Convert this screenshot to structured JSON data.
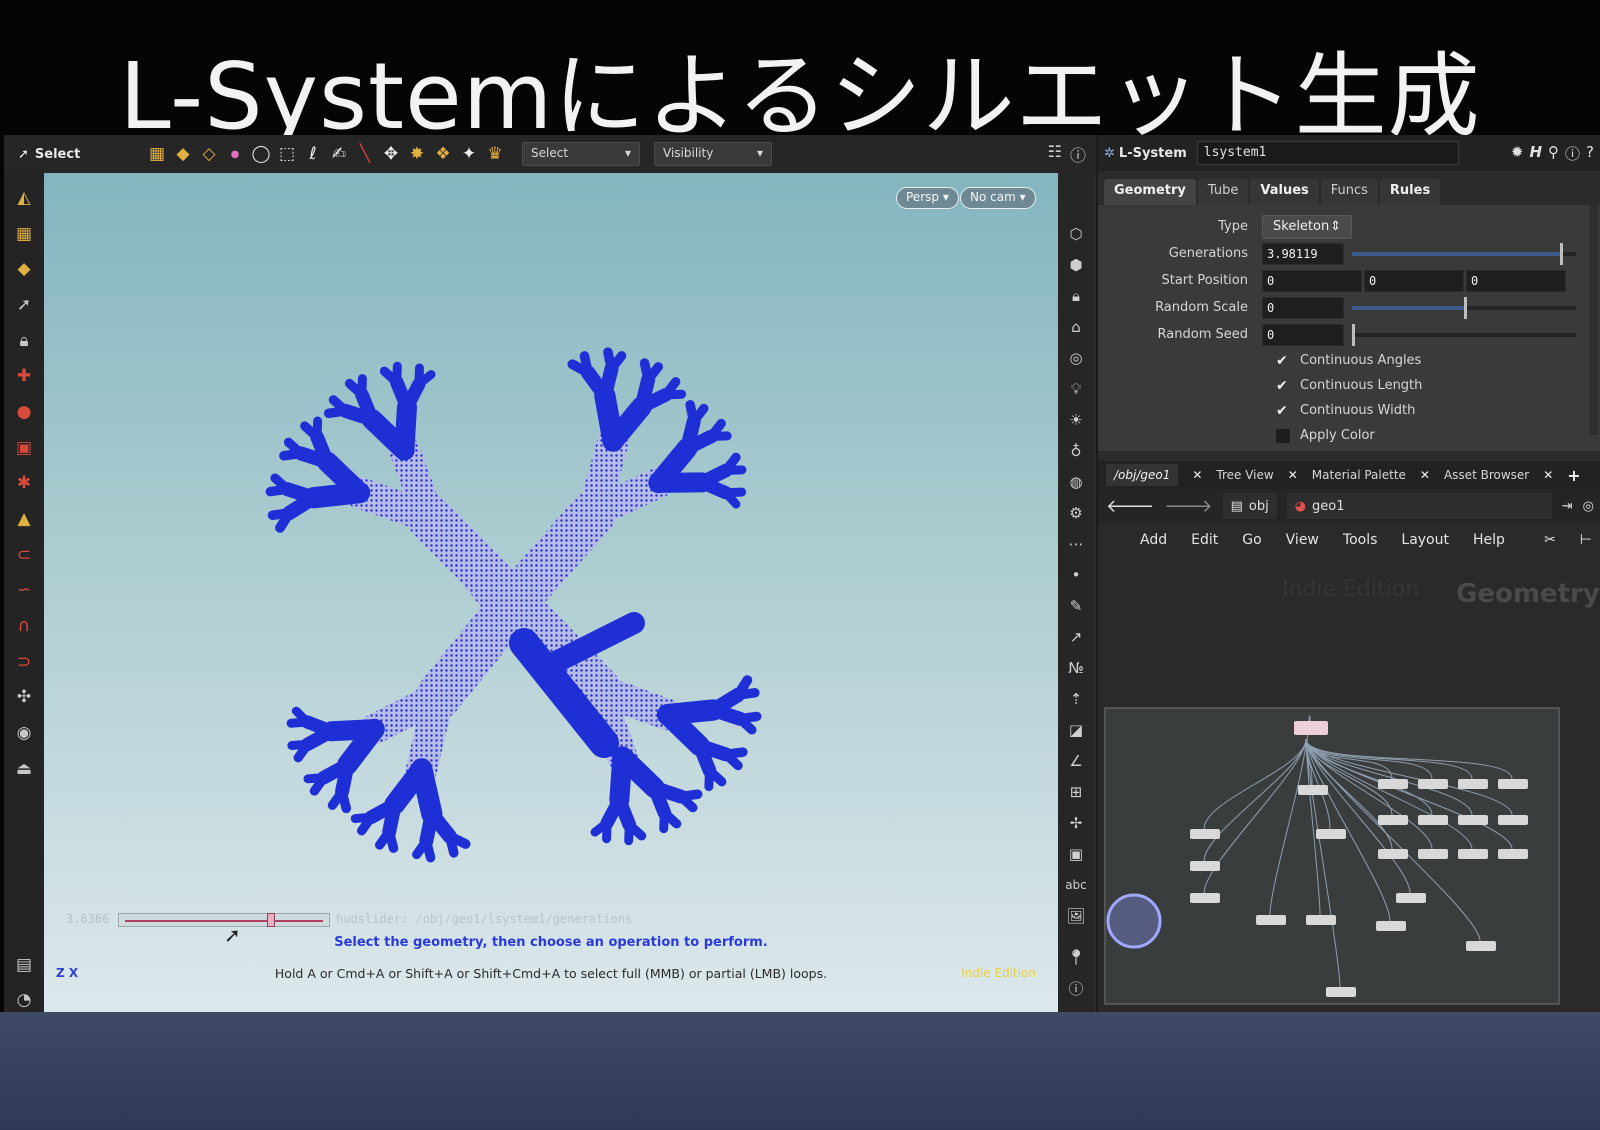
{
  "slide": {
    "title": "L-Systemによるシルエット生成"
  },
  "toolbar": {
    "select_label": "Select",
    "select_dropdown": "Select",
    "visibility_dropdown": "Visibility"
  },
  "viewport": {
    "persp_label": "Persp",
    "cam_label": "No cam",
    "slider_value": "3.6366",
    "slider_path": "hudslider: /obj/geo1/lsystem1/generations",
    "prompt": "Select the geometry, then choose an operation to perform.",
    "hint": "Hold A or Cmd+A or Shift+A or Shift+Cmd+A to select full (MMB) or partial (LMB) loops.",
    "edition": "Indie Edition",
    "axis": "Z X",
    "tree_color": "#1f2fd6"
  },
  "parameters": {
    "node_type": "L-System",
    "node_name": "lsystem1",
    "tabs": [
      "Geometry",
      "Tube",
      "Values",
      "Funcs",
      "Rules"
    ],
    "type_label": "Type",
    "type_value": "Skeleton",
    "generations_label": "Generations",
    "generations_value": "3.98119",
    "generations_fraction": 0.93,
    "start_label": "Start Position",
    "start_values": [
      "0",
      "0",
      "0"
    ],
    "random_scale_label": "Random Scale",
    "random_scale_value": "0",
    "random_scale_fraction": 0.5,
    "random_seed_label": "Random Seed",
    "random_seed_value": "0",
    "checks": [
      {
        "label": "Continuous Angles",
        "on": true
      },
      {
        "label": "Continuous Length",
        "on": true
      },
      {
        "label": "Continuous Width",
        "on": true
      },
      {
        "label": "Apply Color",
        "on": false
      }
    ]
  },
  "network": {
    "tabs": [
      "/obj/geo1",
      "Tree View",
      "Material Palette",
      "Asset Browser"
    ],
    "crumb_obj": "obj",
    "crumb_geo": "geo1",
    "menu": [
      "Add",
      "Edit",
      "Go",
      "View",
      "Tools",
      "Layout",
      "Help"
    ],
    "watermark_edition": "Indie Edition",
    "watermark_context": "Geometry"
  }
}
